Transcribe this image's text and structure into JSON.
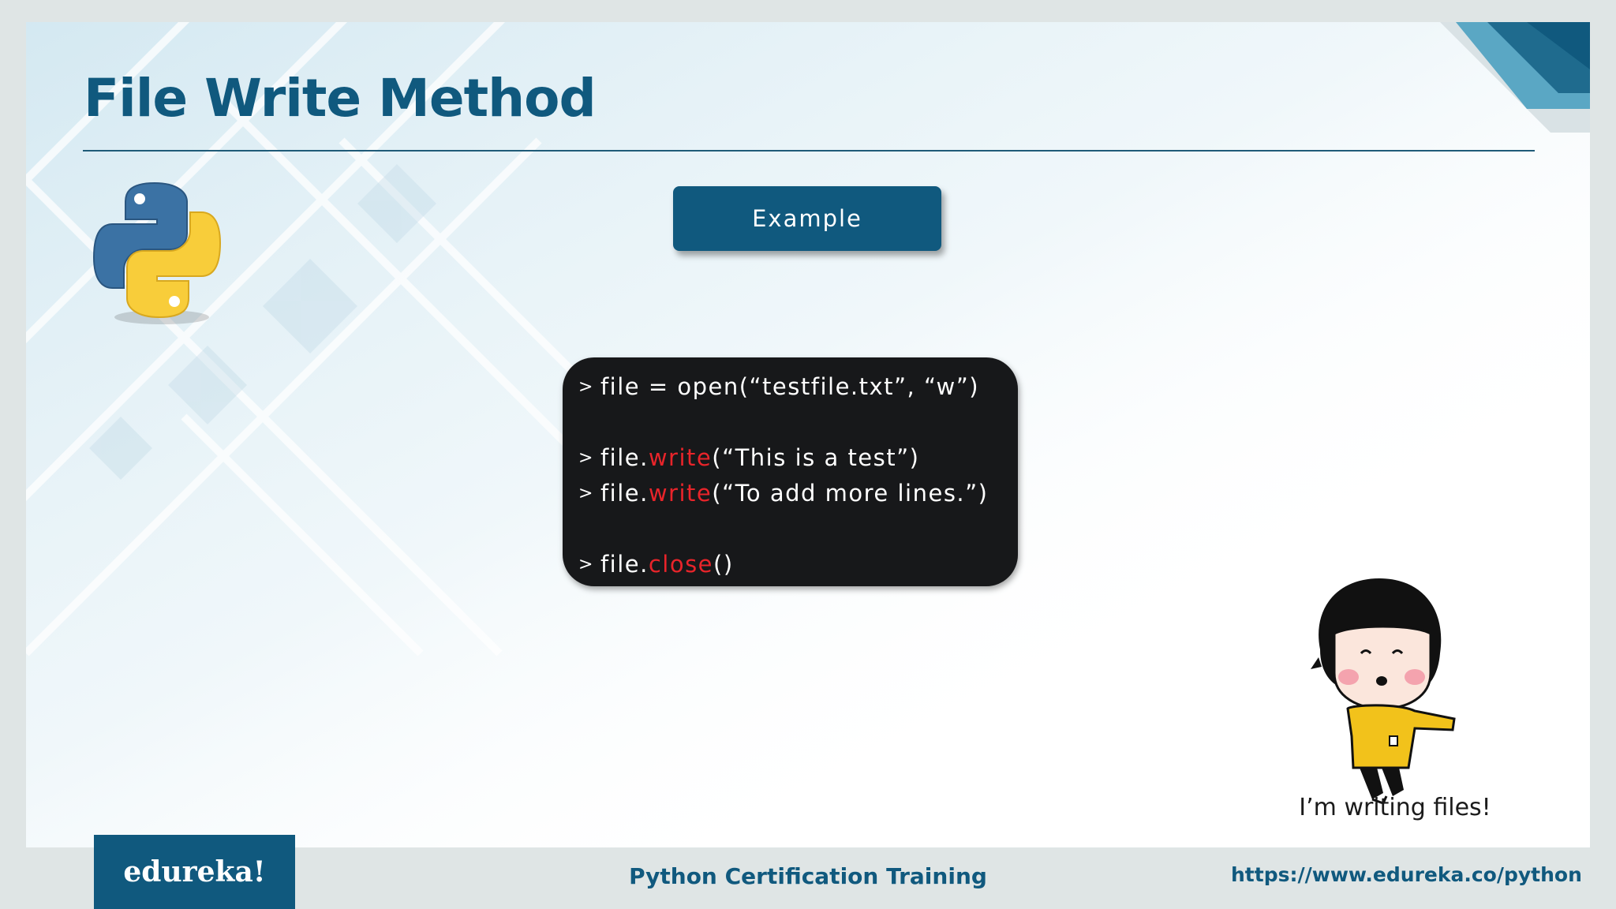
{
  "slide": {
    "title": "File Write Method",
    "example_button": "Example",
    "code": {
      "line1": {
        "prompt": ">",
        "text": "file = open(“testfile.txt”, “w”)"
      },
      "line2": {
        "prompt": ">",
        "obj": "file.",
        "method": "write",
        "args": "(“This is a test”)"
      },
      "line3": {
        "prompt": ">",
        "obj": "file.",
        "method": "write",
        "args": "(“To add more lines.”)"
      },
      "line4": {
        "prompt": ">",
        "obj": "file.",
        "method": "close",
        "args": "()"
      }
    },
    "caption": "I’m writing files!"
  },
  "footer": {
    "brand": "edureka!",
    "course": "Python Certification Training",
    "url": "https://www.edureka.co/python"
  },
  "colors": {
    "brand_blue": "#10597e",
    "code_bg": "#17181a",
    "keyword_red": "#e8242a"
  },
  "icons": [
    "python-logo-icon",
    "cartoon-girl-illustration"
  ]
}
